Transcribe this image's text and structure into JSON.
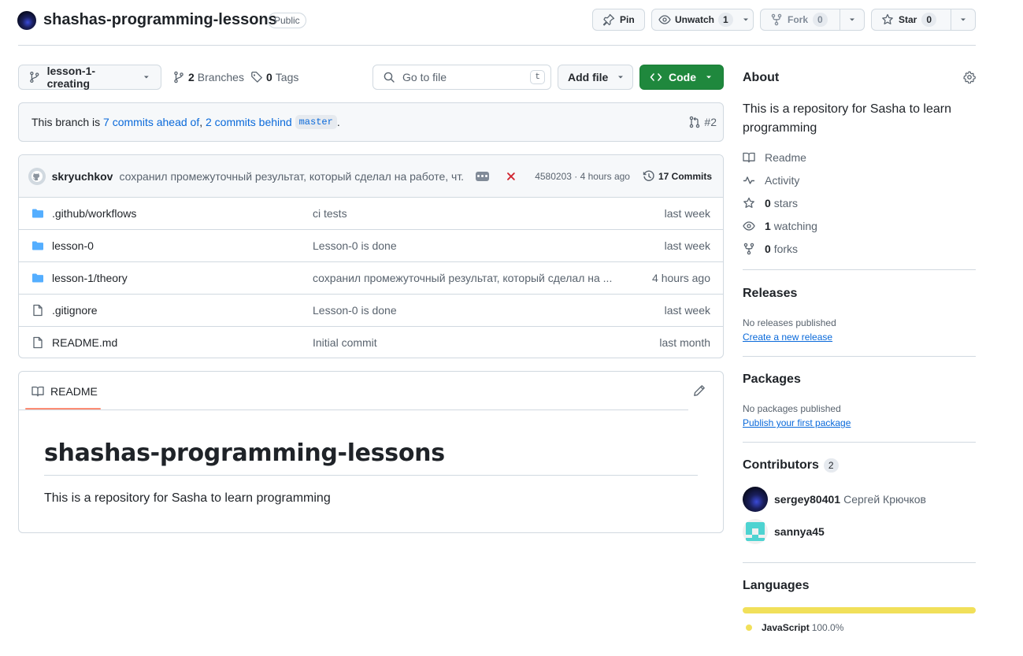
{
  "repo": {
    "name": "shashas-programming-lessons",
    "visibility": "Public"
  },
  "header_actions": {
    "pin_label": "Pin",
    "unwatch_label": "Unwatch",
    "watch_count": "1",
    "fork_label": "Fork",
    "fork_count": "0",
    "star_label": "Star",
    "star_count": "0"
  },
  "toolbar": {
    "branch_name": "lesson-1-creating",
    "branches_count": "2",
    "branches_label": "Branches",
    "tags_count": "0",
    "tags_label": "Tags",
    "goto_placeholder": "Go to file",
    "goto_shortcut": "t",
    "add_file_label": "Add file",
    "code_label": "Code"
  },
  "branch_status": {
    "prefix": "This branch is",
    "ahead": "7 commits ahead of",
    "sep": ",",
    "behind": "2 commits behind",
    "base": "master",
    "suffix": ".",
    "pr": "#2"
  },
  "latest_commit": {
    "author": "skryuchkov",
    "message": "сохранил промежуточный результат, который сделал на работе, чт...",
    "sha_time": "4580203 · 4 hours ago",
    "commits_label": "17 Commits"
  },
  "files": [
    {
      "type": "folder",
      "name": ".github/workflows",
      "message": "ci tests",
      "age": "last week"
    },
    {
      "type": "folder",
      "name": "lesson-0",
      "message": "Lesson-0 is done",
      "age": "last week"
    },
    {
      "type": "folder",
      "name": "lesson-1/theory",
      "message": "сохранил промежуточный результат, который сделал на ...",
      "age": "4 hours ago"
    },
    {
      "type": "file",
      "name": ".gitignore",
      "message": "Lesson-0 is done",
      "age": "last week"
    },
    {
      "type": "file",
      "name": "README.md",
      "message": "Initial commit",
      "age": "last month"
    }
  ],
  "readme": {
    "tab_label": "README",
    "heading": "shashas-programming-lessons",
    "body": "This is a repository for Sasha to learn programming"
  },
  "about": {
    "title": "About",
    "description": "This is a repository for Sasha to learn programming",
    "readme": "Readme",
    "activity": "Activity",
    "stars_count": "0",
    "stars_label": "stars",
    "watching_count": "1",
    "watching_label": "watching",
    "forks_count": "0",
    "forks_label": "forks"
  },
  "releases": {
    "title": "Releases",
    "empty": "No releases published",
    "link": "Create a new release"
  },
  "packages": {
    "title": "Packages",
    "empty": "No packages published",
    "link": "Publish your first package"
  },
  "contributors": {
    "title": "Contributors",
    "count": "2",
    "list": [
      {
        "login": "sergey80401",
        "name": "Сергей Крючков"
      },
      {
        "login": "sannya45",
        "name": ""
      }
    ]
  },
  "languages": {
    "title": "Languages",
    "list": [
      {
        "name": "JavaScript",
        "percent": "100.0%",
        "fraction": 1.0,
        "color": "#f1e05a"
      }
    ]
  },
  "colors": {
    "accent": "#0969da",
    "code_button": "#1f883d",
    "danger": "#d1242f",
    "folder": "#54aeff"
  }
}
